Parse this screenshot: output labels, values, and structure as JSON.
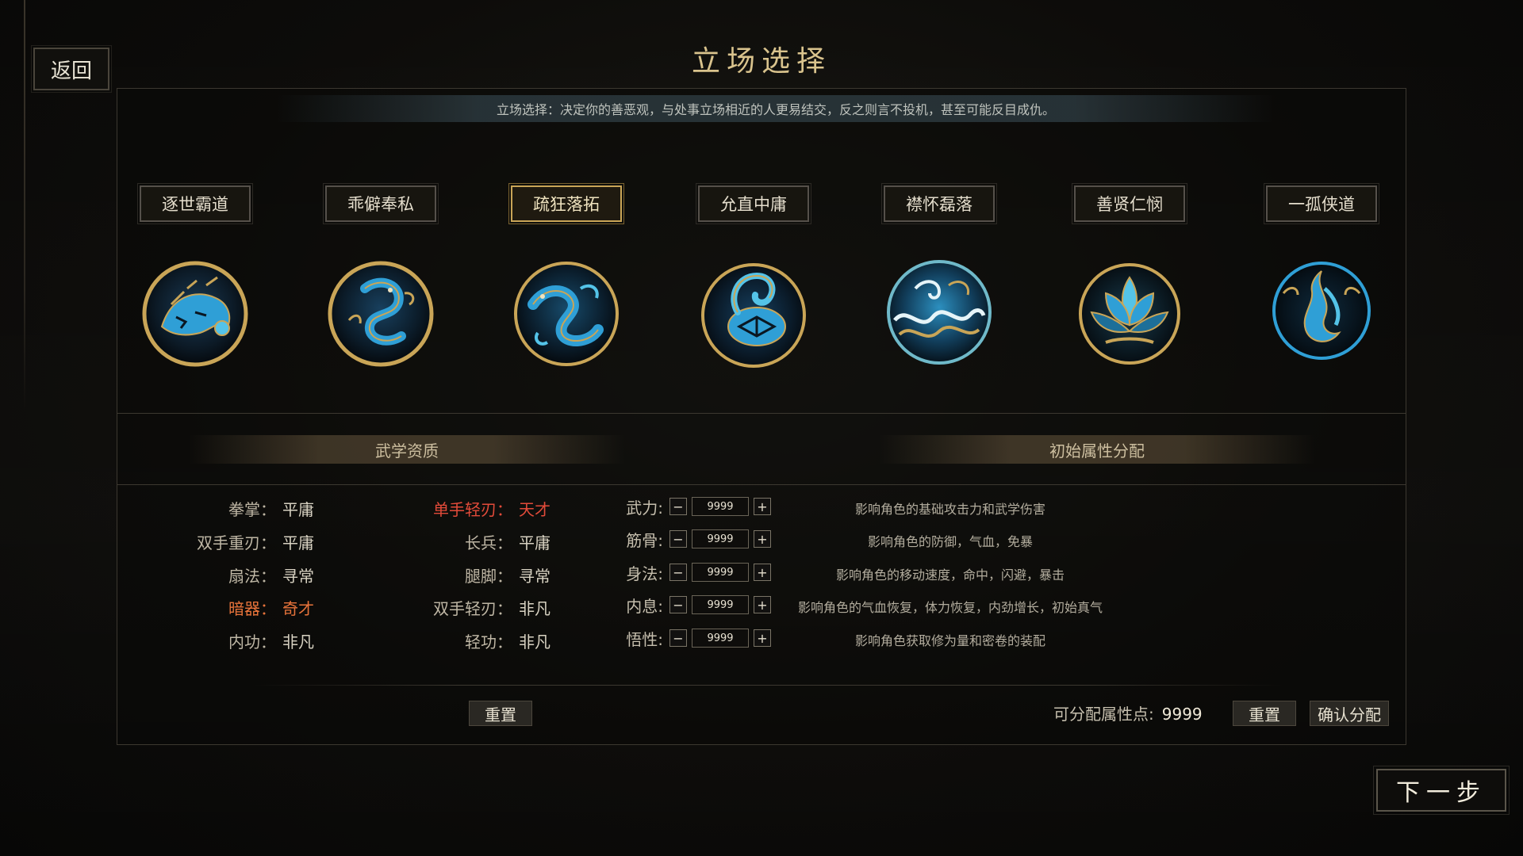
{
  "header": {
    "back_label": "返回",
    "title": "立场选择"
  },
  "description": "立场选择：决定你的善恶观，与处事立场相近的人更易结交，反之则言不投机，甚至可能反目成仇。",
  "stances": [
    {
      "label": "逐世霸道",
      "emblem": "tiger-emblem-icon",
      "selected": false
    },
    {
      "label": "乖僻奉私",
      "emblem": "dragon-emblem-icon",
      "selected": false
    },
    {
      "label": "疏狂落拓",
      "emblem": "serpent-dragon-emblem-icon",
      "selected": true
    },
    {
      "label": "允直中庸",
      "emblem": "turtle-snake-emblem-icon",
      "selected": false
    },
    {
      "label": "襟怀磊落",
      "emblem": "waves-emblem-icon",
      "selected": false
    },
    {
      "label": "善贤仁悯",
      "emblem": "lotus-emblem-icon",
      "selected": false
    },
    {
      "label": "一孤侠道",
      "emblem": "phoenix-flame-emblem-icon",
      "selected": false
    }
  ],
  "sections": {
    "aptitude_title": "武学资质",
    "attributes_title": "初始属性分配"
  },
  "aptitudes": {
    "left": [
      {
        "key": "拳掌：",
        "value": "平庸",
        "tone": "normal"
      },
      {
        "key": "双手重刃：",
        "value": "平庸",
        "tone": "normal"
      },
      {
        "key": "扇法：",
        "value": "寻常",
        "tone": "normal"
      },
      {
        "key": "暗器：",
        "value": "奇才",
        "tone": "orange"
      },
      {
        "key": "内功：",
        "value": "非凡",
        "tone": "normal"
      }
    ],
    "right": [
      {
        "key": "单手轻刃：",
        "value": "天才",
        "tone": "red"
      },
      {
        "key": "长兵：",
        "value": "平庸",
        "tone": "normal"
      },
      {
        "key": "腿脚：",
        "value": "寻常",
        "tone": "normal"
      },
      {
        "key": "双手轻刃：",
        "value": "非凡",
        "tone": "normal"
      },
      {
        "key": "轻功：",
        "value": "非凡",
        "tone": "normal"
      }
    ],
    "reset_label": "重置"
  },
  "attributes": {
    "rows": [
      {
        "label": "武力:",
        "value": "9999",
        "desc": "影响角色的基础攻击力和武学伤害"
      },
      {
        "label": "筋骨:",
        "value": "9999",
        "desc": "影响角色的防御，气血，免暴"
      },
      {
        "label": "身法:",
        "value": "9999",
        "desc": "影响角色的移动速度，命中，闪避，暴击"
      },
      {
        "label": "内息:",
        "value": "9999",
        "desc": "影响角色的气血恢复，体力恢复，内劲增长，初始真气"
      },
      {
        "label": "悟性:",
        "value": "9999",
        "desc": "影响角色获取修为量和密卷的装配"
      }
    ],
    "minus_symbol": "−",
    "plus_symbol": "+",
    "points_label": "可分配属性点:",
    "points_value": "9999",
    "reset_label": "重置",
    "confirm_label": "确认分配"
  },
  "footer": {
    "next_label": "下一步"
  },
  "colors": {
    "gold": "#c9a557",
    "red": "#e34b3a",
    "orange": "#e9743b",
    "emblem_blue": "#2f9fd6"
  }
}
